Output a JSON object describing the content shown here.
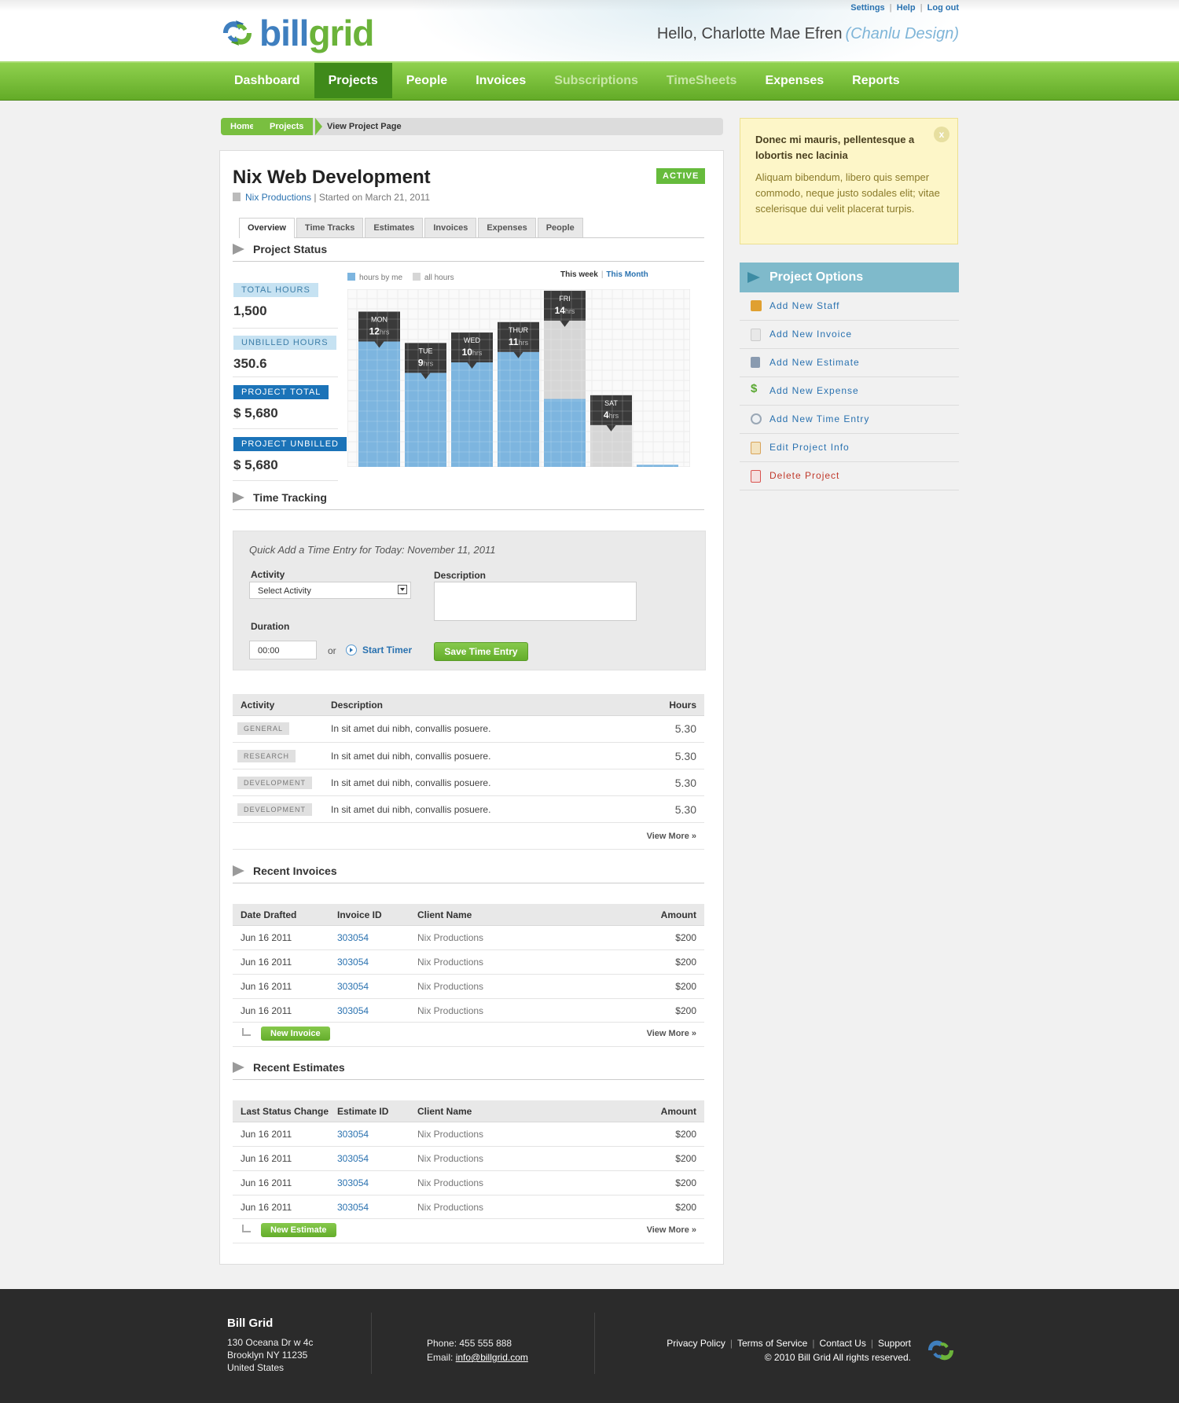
{
  "header": {
    "logo_part1": "bill",
    "logo_part2": "grid",
    "links": [
      "Settings",
      "Help",
      "Log out"
    ],
    "greeting": "Hello, Charlotte Mae Efren",
    "company": "(Chanlu Design)"
  },
  "nav": {
    "items": [
      "Dashboard",
      "Projects",
      "People",
      "Invoices",
      "Subscriptions",
      "TimeSheets",
      "Expenses",
      "Reports"
    ],
    "active": "Projects"
  },
  "breadcrumb": {
    "home": "Home",
    "projects": "Projects",
    "current": "View Project Page"
  },
  "project": {
    "title": "Nix Web Development",
    "client": "Nix Productions",
    "started": "| Started on March 21, 2011",
    "status": "ACTIVE"
  },
  "tabs": [
    "Overview",
    "Time Tracks",
    "Estimates",
    "Invoices",
    "Expenses",
    "People"
  ],
  "project_status": {
    "heading": "Project Status",
    "stats": [
      {
        "label": "TOTAL HOURS",
        "value": "1,500"
      },
      {
        "label": "UNBILLED HOURS",
        "value": "350.6"
      },
      {
        "label": "PROJECT TOTAL",
        "value": "$ 5,680"
      },
      {
        "label": "PROJECT UNBILLED",
        "value": "$ 5,680"
      }
    ],
    "legend_me": "hours by me",
    "legend_all": "all hours",
    "range_week": "This week",
    "range_month": "This Month",
    "hrs_unit": "hrs"
  },
  "chart_data": {
    "type": "bar",
    "categories": [
      "MON",
      "TUE",
      "WED",
      "THUR",
      "FRI",
      "SAT",
      "SUN"
    ],
    "series": [
      {
        "name": "hours by me",
        "values": [
          12,
          9,
          10,
          11,
          6.5,
          0,
          0.2
        ]
      },
      {
        "name": "all hours",
        "values": [
          12,
          9,
          10,
          11,
          14,
          4,
          0.2
        ]
      }
    ],
    "labels": [
      12,
      9,
      10,
      11,
      14,
      4,
      null
    ],
    "colors": {
      "me": "#7db5df",
      "all": "#d6d6d6",
      "tag": "#3a3a3a"
    },
    "ylim": [
      0,
      17
    ],
    "grid": true
  },
  "time_tracking": {
    "heading": "Time Tracking",
    "quick_add": "Quick Add a Time Entry for  Today: November 11, 2011",
    "activity_label": "Activity",
    "activity_value": "Select Activity",
    "description_label": "Description",
    "duration_label": "Duration",
    "duration_value": "00:00",
    "or": "or",
    "start_timer": "Start Timer",
    "save": "Save Time Entry",
    "columns": [
      "Activity",
      "Description",
      "Hours"
    ],
    "rows": [
      {
        "activity": "GENERAL",
        "description": "In sit amet dui nibh, convallis posuere.",
        "hours": "5.30"
      },
      {
        "activity": "RESEARCH",
        "description": "In sit amet dui nibh, convallis posuere.",
        "hours": "5.30"
      },
      {
        "activity": "DEVELOPMENT",
        "description": "In sit amet dui nibh, convallis posuere.",
        "hours": "5.30"
      },
      {
        "activity": "DEVELOPMENT",
        "description": "In sit amet dui nibh, convallis posuere.",
        "hours": "5.30"
      }
    ],
    "view_more": "View More »"
  },
  "invoices": {
    "heading": "Recent Invoices",
    "columns": [
      "Date Drafted",
      "Invoice ID",
      "Client Name",
      "Amount"
    ],
    "rows": [
      {
        "date": "Jun 16 2011",
        "id": "303054",
        "client": "Nix Productions",
        "amount": "$200"
      },
      {
        "date": "Jun 16 2011",
        "id": "303054",
        "client": "Nix Productions",
        "amount": "$200"
      },
      {
        "date": "Jun 16 2011",
        "id": "303054",
        "client": "Nix Productions",
        "amount": "$200"
      },
      {
        "date": "Jun 16 2011",
        "id": "303054",
        "client": "Nix Productions",
        "amount": "$200"
      }
    ],
    "new_button": "New Invoice",
    "view_more": "View More »"
  },
  "estimates": {
    "heading": "Recent Estimates",
    "columns": [
      "Last Status Change",
      "Estimate ID",
      "Client Name",
      "Amount"
    ],
    "rows": [
      {
        "date": "Jun 16 2011",
        "id": "303054",
        "client": "Nix Productions",
        "amount": "$200"
      },
      {
        "date": "Jun 16 2011",
        "id": "303054",
        "client": "Nix Productions",
        "amount": "$200"
      },
      {
        "date": "Jun 16 2011",
        "id": "303054",
        "client": "Nix Productions",
        "amount": "$200"
      },
      {
        "date": "Jun 16 2011",
        "id": "303054",
        "client": "Nix Productions",
        "amount": "$200"
      }
    ],
    "new_button": "New Estimate",
    "view_more": "View More »"
  },
  "notice": {
    "title": "Donec mi mauris, pellentesque a lobortis nec lacinia",
    "body": "Aliquam bibendum, libero quis semper commodo, neque justo sodales elit; vitae scelerisque dui velit placerat turpis.",
    "close": "x"
  },
  "options": {
    "heading": "Project Options",
    "items": [
      {
        "label": "Add New Staff",
        "icon": "staff-icon",
        "color": "#e0a030"
      },
      {
        "label": "Add New Invoice",
        "icon": "document-icon",
        "color": "#d8d8d8"
      },
      {
        "label": "Add New Estimate",
        "icon": "calculator-icon",
        "color": "#8a9bb0"
      },
      {
        "label": "Add New Expense",
        "icon": "dollar-icon",
        "color": "#5aa832"
      },
      {
        "label": "Add New Time Entry",
        "icon": "clock-icon",
        "color": "#9aa7b5"
      },
      {
        "label": "Edit Project Info",
        "icon": "edit-icon",
        "color": "#d9a45a"
      },
      {
        "label": "Delete Project",
        "icon": "delete-icon",
        "color": "#d9534f"
      }
    ]
  },
  "footer": {
    "name": "Bill Grid",
    "address": [
      "130 Oceana Dr w 4c",
      "Brooklyn NY 11235",
      "United States"
    ],
    "phone": "Phone: 455 555 888",
    "email_label": "Email: ",
    "email": "info@billgrid.com",
    "links": [
      "Privacy Policy",
      "Terms of Service",
      "Contact Us",
      "Support"
    ],
    "copyright": "© 2010 Bill Grid All rights reserved."
  }
}
